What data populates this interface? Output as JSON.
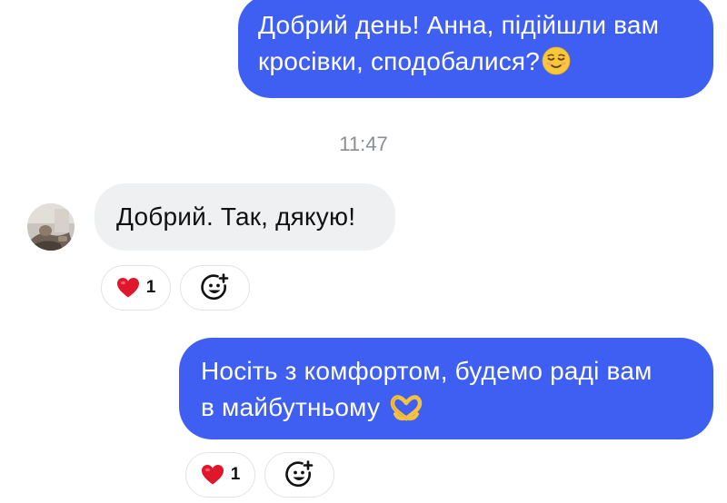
{
  "messages": [
    {
      "direction": "outgoing",
      "lines": [
        "Добрий день! Анна, підійшли вам",
        "кросівки, сподобалися?"
      ],
      "emoji": "relieved-face-emoji"
    },
    {
      "direction": "incoming",
      "text": "Добрий. Так, дякую!"
    },
    {
      "direction": "outgoing",
      "lines": [
        "Носіть з комфортом, будемо раді вам",
        "в майбутньому"
      ],
      "emoji": "heart-hands-emoji"
    }
  ],
  "timestamp": "11:47",
  "reactions": [
    {
      "emoji": "heart-icon",
      "count": "1"
    },
    {
      "emoji": "heart-icon",
      "count": "1"
    }
  ],
  "colors": {
    "outgoing_bubble": "#3f5ff3",
    "incoming_bubble": "#eff0f2",
    "timestamp": "#8a8d93",
    "heart": "#e0162b"
  }
}
